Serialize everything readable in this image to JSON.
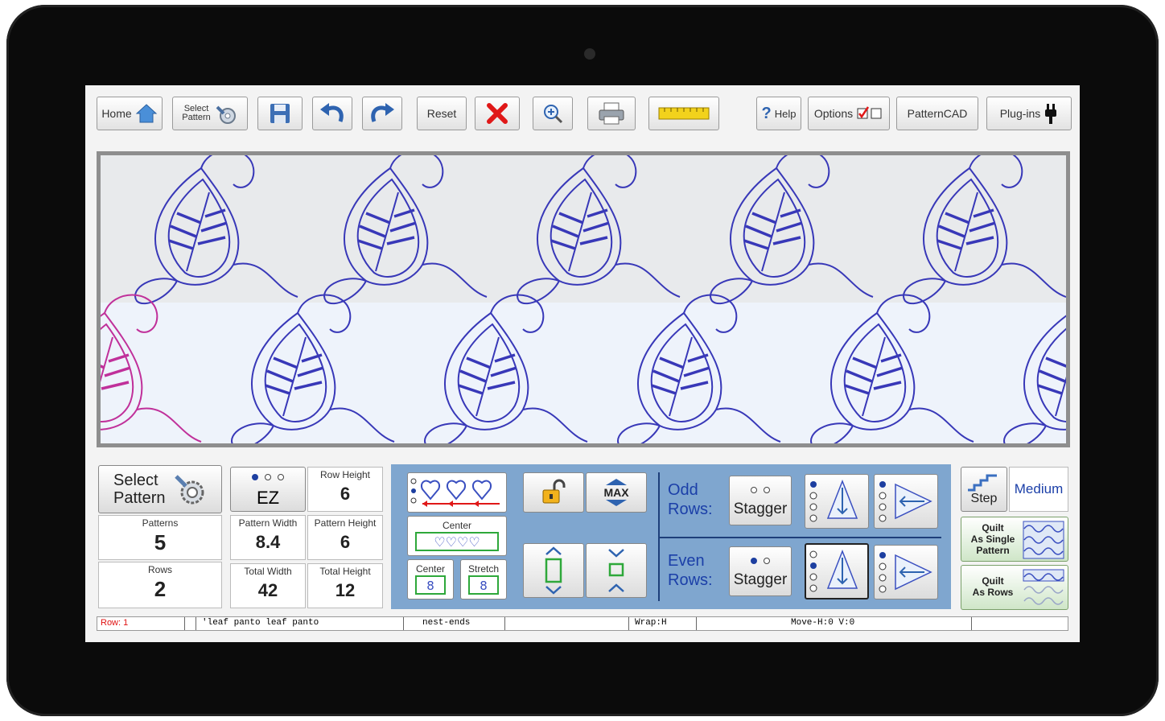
{
  "toolbar": {
    "home": "Home",
    "select_pattern_line1": "Select",
    "select_pattern_line2": "Pattern",
    "reset": "Reset",
    "help": "Help",
    "options": "Options",
    "patterncad": "PatternCAD",
    "plugins": "Plug-ins"
  },
  "icons": [
    "home-icon",
    "select-pattern-icon",
    "save-icon",
    "undo-icon",
    "redo-icon",
    "delete-icon",
    "zoom-icon",
    "print-icon",
    "ruler-icon",
    "help-icon",
    "options-checkbox-icon",
    "plug-icon"
  ],
  "colors": {
    "pattern_blue": "#3838b8",
    "pattern_pink": "#c0309a",
    "panel_blue": "#7fa6cf",
    "label_blue": "#1b3fa8",
    "status_red": "#e01010"
  },
  "left_panel": {
    "select_pattern_line1": "Select",
    "select_pattern_line2": "Pattern",
    "patterns_label": "Patterns",
    "patterns_value": "5",
    "rows_label": "Rows",
    "rows_value": "2",
    "ez_label": "EZ",
    "row_height_label": "Row Height",
    "row_height_value": "6",
    "pattern_width_label": "Pattern Width",
    "pattern_width_value": "8.4",
    "pattern_height_label": "Pattern Height",
    "pattern_height_value": "6",
    "total_width_label": "Total Width",
    "total_width_value": "42",
    "total_height_label": "Total Height",
    "total_height_value": "12"
  },
  "center_panel": {
    "center_label": "Center",
    "center2_label": "Center",
    "stretch_label": "Stretch",
    "max_label": "MAX",
    "odd_rows_line1": "Odd",
    "odd_rows_line2": "Rows:",
    "even_rows_line1": "Even",
    "even_rows_line2": "Rows:",
    "stagger_odd": "Stagger",
    "stagger_even": "Stagger"
  },
  "right_panel": {
    "step": "Step",
    "medium": "Medium",
    "quilt_single_line1": "Quilt",
    "quilt_single_line2": "As Single",
    "quilt_single_line3": "Pattern",
    "quilt_rows_line1": "Quilt",
    "quilt_rows_line2": "As Rows"
  },
  "status_bar": {
    "row": "Row: 1",
    "pattern_name": "'leaf panto leaf panto",
    "mode": "nest-ends",
    "wrap": "Wrap:H",
    "move": "Move-H:0 V:0"
  }
}
